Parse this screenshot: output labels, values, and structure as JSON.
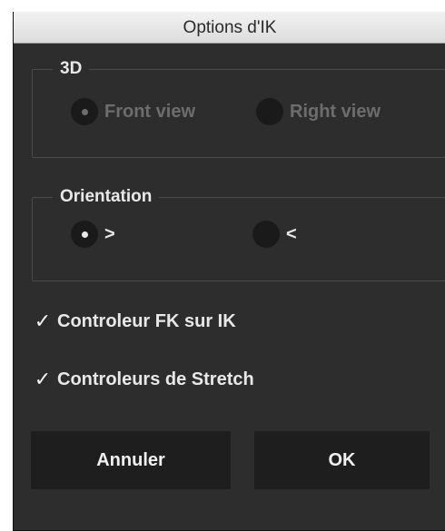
{
  "dialog": {
    "title": "Options d'IK"
  },
  "group_3d": {
    "title": "3D",
    "options": [
      {
        "label": "Front view",
        "selected": true,
        "enabled": false
      },
      {
        "label": "Right view",
        "selected": false,
        "enabled": false
      }
    ]
  },
  "group_orientation": {
    "title": "Orientation",
    "options": [
      {
        "label": ">",
        "selected": true,
        "enabled": true
      },
      {
        "label": "<",
        "selected": false,
        "enabled": true
      }
    ]
  },
  "checkboxes": [
    {
      "label": "Controleur FK sur IK",
      "checked": true,
      "check_glyph": "✓"
    },
    {
      "label": "Controleurs de Stretch",
      "checked": true,
      "check_glyph": "✓"
    }
  ],
  "buttons": {
    "cancel_label": "Annuler",
    "ok_label": "OK"
  },
  "colors": {
    "dialog_bg": "#2d2d2d",
    "titlebar_bg": "#e6e6e6",
    "text": "#e8e8e8",
    "disabled_text": "#6d6d6d",
    "button_bg": "#1e1e1e"
  }
}
